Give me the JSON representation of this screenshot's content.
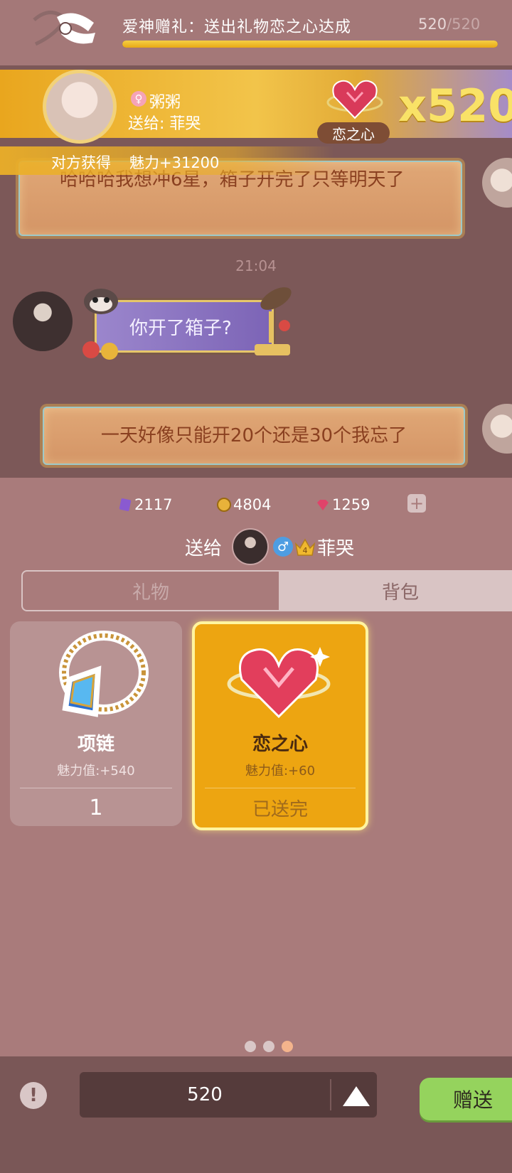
{
  "quest": {
    "title": "爱神赠礼：送出礼物恋之心达成",
    "progress_current": "520",
    "progress_separator": "/",
    "progress_total": "520",
    "progress_fraction": 1.0,
    "icon": "ribbon-scroll-icon"
  },
  "chat": {
    "messages": [
      {
        "text": "哈哈哈我想冲6星，箱子开完了只等明天了"
      },
      {
        "text": "你开了箱子?"
      },
      {
        "text": "一天好像只能开20个还是30个我忘了"
      }
    ],
    "time": "21:04"
  },
  "gift_notice": {
    "sender_name": "粥粥",
    "send_to": "送给: 菲哭",
    "gift_name": "恋之心",
    "multiplier": "x520",
    "reward_label": "对方获得",
    "reward_value": "魅力+31200"
  },
  "currencies": [
    {
      "icon": "purple-card-icon",
      "value": "2117"
    },
    {
      "icon": "gold-coin-icon",
      "value": "4804"
    },
    {
      "icon": "red-gem-icon",
      "value": "1259"
    }
  ],
  "recipient": {
    "label": "送给",
    "name": "菲哭",
    "gender_symbol": "♂",
    "crown_level": "4"
  },
  "tabs": {
    "gift": "礼物",
    "bag": "背包",
    "active": "bag"
  },
  "items": [
    {
      "name": "项链",
      "charm": "魅力值:+540",
      "bottom": "1",
      "icon": "necklace-icon"
    },
    {
      "name": "恋之心",
      "charm": "魅力值:+60",
      "bottom": "已送完",
      "icon": "gem-heart-icon",
      "selected": true
    }
  ],
  "pager": {
    "count": 3,
    "active_index": 2
  },
  "bottom": {
    "quantity": "520",
    "send_label": "赠送"
  },
  "colors": {
    "accent_gold": "#eda511",
    "send_green": "#95d35d",
    "background": "#a97b7b"
  }
}
